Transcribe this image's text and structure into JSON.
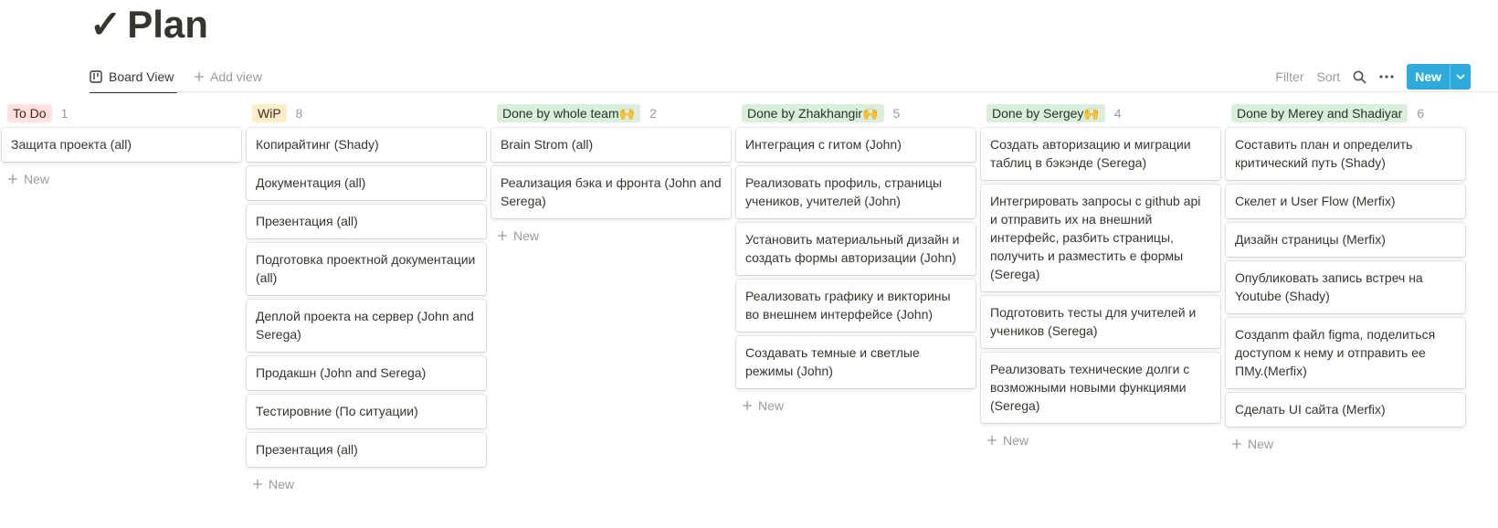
{
  "page": {
    "title_icon": "✓",
    "title": "Plan"
  },
  "views": {
    "active": "Board View",
    "add_view": "Add view",
    "filter": "Filter",
    "sort": "Sort",
    "new_button": "New"
  },
  "colors": {
    "accent": "#2eaadc"
  },
  "board": {
    "new_label": "New",
    "columns": [
      {
        "name": "To Do",
        "count": "1",
        "tag_bg": "#ffe2dd",
        "tag_color": "#5d1715",
        "cards": [
          "Защита проекта (all)"
        ]
      },
      {
        "name": "WiP",
        "count": "8",
        "tag_bg": "#fdecc8",
        "tag_color": "#402c1b",
        "cards": [
          "Копирайтинг (Shady)",
          "Документация (all)",
          "Презентация (all)",
          "Подготовка проектной документации (all)",
          "Деплой проекта на сервер (John and Serega)",
          "Продакшн (John and Serega)",
          "Тестировние (По ситуации)",
          "Презентация (all)"
        ]
      },
      {
        "name": "Done by whole team🙌",
        "count": "2",
        "tag_bg": "#dbeddb",
        "tag_color": "#1c3829",
        "cards": [
          "Brain Strom (all)",
          "Реализация бэка и фронта (John and Serega)"
        ]
      },
      {
        "name": "Done by Zhakhangir🙌",
        "count": "5",
        "tag_bg": "#dbeddb",
        "tag_color": "#1c3829",
        "cards": [
          "Интеграция с гитом (John)",
          "Реализовать профиль, страницы учеников, учителей (John)",
          "Установить материальный дизайн и создать формы авторизации (John)",
          "Реализовать графику и викторины во внешнем интерфейсе (John)",
          "Создавать темные и светлые режимы (John)"
        ]
      },
      {
        "name": "Done by Sergey🙌",
        "count": "4",
        "tag_bg": "#dbeddb",
        "tag_color": "#1c3829",
        "cards": [
          "Создать авторизацию и миграции таблиц в бэкэнде (Serega)",
          "Интегрировать запросы с github api и отправить их на внешний интерфейс, разбить страницы, получить и разместить е формы (Serega)",
          "Подготовить тесты для учителей и учеников (Serega)",
          "Реализовать технические долги с возможными новыми функциями (Serega)"
        ]
      },
      {
        "name": "Done by Merey and Shadiyar",
        "count": "6",
        "tag_bg": "#dbeddb",
        "tag_color": "#1c3829",
        "cards": [
          "Составить план и определить критический путь (Shady)",
          "Скелет и User Flow (Merfix)",
          "Дизайн страницы (Merfix)",
          "Опубликовать запись встреч на Youtube (Shady)",
          "Создаnm файл figma, поделиться доступом к нему и отправить ее ПМу.(Merfix)",
          "Сделать UI сайта (Merfix)"
        ]
      }
    ]
  }
}
